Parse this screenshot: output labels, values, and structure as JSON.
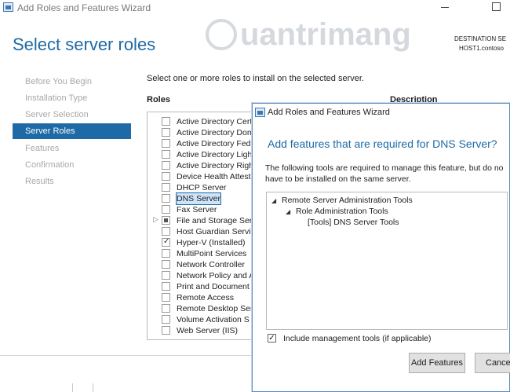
{
  "window": {
    "title": "Add Roles and Features Wizard",
    "page_title": "Select server roles",
    "destination_label": "DESTINATION SE",
    "destination_host": "HOST1.contoso"
  },
  "watermark": {
    "text": "uantrimang"
  },
  "nav": {
    "items": [
      {
        "label": "Before You Begin",
        "state": "disabled"
      },
      {
        "label": "Installation Type",
        "state": "disabled"
      },
      {
        "label": "Server Selection",
        "state": "disabled"
      },
      {
        "label": "Server Roles",
        "state": "active"
      },
      {
        "label": "Features",
        "state": "disabled"
      },
      {
        "label": "Confirmation",
        "state": "disabled"
      },
      {
        "label": "Results",
        "state": "disabled"
      }
    ]
  },
  "main": {
    "instruction": "Select one or more roles to install on the selected server.",
    "roles_header": "Roles",
    "description_header": "Description",
    "roles": [
      {
        "label": "Active Directory Cert",
        "checked": false
      },
      {
        "label": "Active Directory Dom",
        "checked": false
      },
      {
        "label": "Active Directory Fed",
        "checked": false
      },
      {
        "label": "Active Directory Ligh",
        "checked": false
      },
      {
        "label": "Active Directory Righ",
        "checked": false
      },
      {
        "label": "Device Health Attest",
        "checked": false
      },
      {
        "label": "DHCP Server",
        "checked": false
      },
      {
        "label": "DNS Server",
        "checked": false,
        "selected": true
      },
      {
        "label": "Fax Server",
        "checked": false
      },
      {
        "label": "File and Storage Ser",
        "checked": "partial",
        "expandable": true
      },
      {
        "label": "Host Guardian Servic",
        "checked": false
      },
      {
        "label": "Hyper-V (Installed)",
        "checked": true
      },
      {
        "label": "MultiPoint Services",
        "checked": false
      },
      {
        "label": "Network Controller",
        "checked": false
      },
      {
        "label": "Network Policy and A",
        "checked": false
      },
      {
        "label": "Print and Document",
        "checked": false
      },
      {
        "label": "Remote Access",
        "checked": false
      },
      {
        "label": "Remote Desktop Ser",
        "checked": false
      },
      {
        "label": "Volume Activation S",
        "checked": false
      },
      {
        "label": "Web Server (IIS)",
        "checked": false
      }
    ]
  },
  "dialog": {
    "title": "Add Roles and Features Wizard",
    "heading": "Add features that are required for DNS Server?",
    "text_line1": "The following tools are required to manage this feature, but do no",
    "text_line2": "have to be installed on the same server.",
    "tree": [
      {
        "label": "Remote Server Administration Tools",
        "level": 0,
        "expanded": true
      },
      {
        "label": "Role Administration Tools",
        "level": 1,
        "expanded": true
      },
      {
        "label": "[Tools] DNS Server Tools",
        "level": 2
      }
    ],
    "include_management_label": "Include management tools (if applicable)",
    "include_management_checked": true,
    "add_button": "Add Features",
    "cancel_button": "Cance"
  },
  "colors": {
    "accent": "#1d6aa6",
    "nav_disabled": "#a8a8a8"
  }
}
